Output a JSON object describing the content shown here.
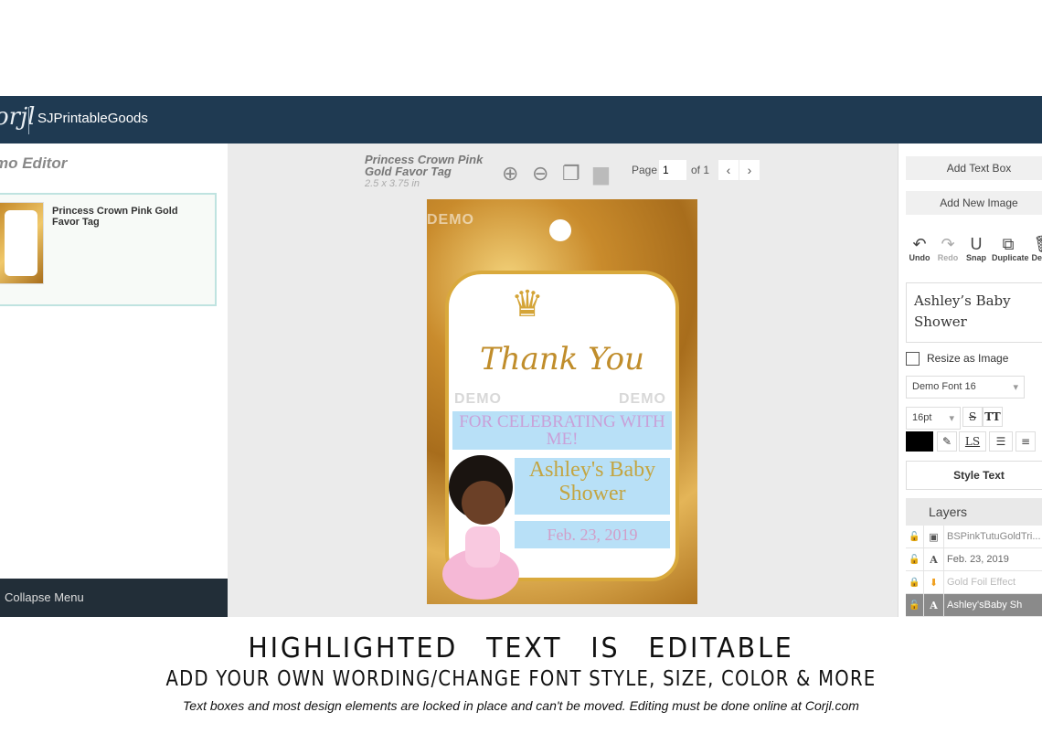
{
  "nav": {
    "logo": "orjl",
    "brand": "SJPrintableGoods"
  },
  "left": {
    "title": "mo Editor",
    "card_title": "Princess Crown Pink Gold Favor Tag",
    "collapse": "Collapse Menu"
  },
  "canvas": {
    "doc_title": "Princess Crown Pink Gold Favor Tag",
    "doc_size": "2.5 x 3.75 in",
    "page_label": "Page",
    "page_value": "1",
    "of_label": "of 1",
    "tag": {
      "thanks": "Thank You",
      "line1": "FOR CELEBRATING WITH ME!",
      "line2": "Ashley's Baby Shower",
      "line3": "Feb. 23, 2019",
      "watermark": "DEMO"
    }
  },
  "right": {
    "add_text": "Add Text Box",
    "add_image": "Add New Image",
    "actions": [
      {
        "label": "Undo",
        "icon": "↶"
      },
      {
        "label": "Redo",
        "icon": "↷"
      },
      {
        "label": "Snap",
        "icon": "U"
      },
      {
        "label": "Duplicate",
        "icon": "⧉"
      },
      {
        "label": "Delete",
        "icon": "🗑"
      }
    ],
    "preview": "Ashley’s Baby Shower",
    "resize": "Resize as Image",
    "font": "Demo Font 16",
    "size": "16pt",
    "ls": "LS",
    "tt": "TT",
    "style_text": "Style Text",
    "layers_title": "Layers",
    "layers": [
      {
        "name": "BSPinkTutuGoldTri...",
        "type": "img"
      },
      {
        "name": "Feb. 23, 2019",
        "type": "A"
      },
      {
        "name": "Gold Foil Effect",
        "type": "⬇"
      },
      {
        "name": "Ashley'sBaby Sh",
        "type": "A"
      }
    ],
    "color": "#000000"
  },
  "caption": {
    "line1": "HIGHLIGHTED TEXT IS EDITABLE",
    "line2": "ADD YOUR OWN WORDING/CHANGE FONT STYLE, SIZE, COLOR & MORE",
    "line3": "Text boxes and most design elements are locked in place and can't be moved. Editing must be done online at Corjl.com"
  }
}
